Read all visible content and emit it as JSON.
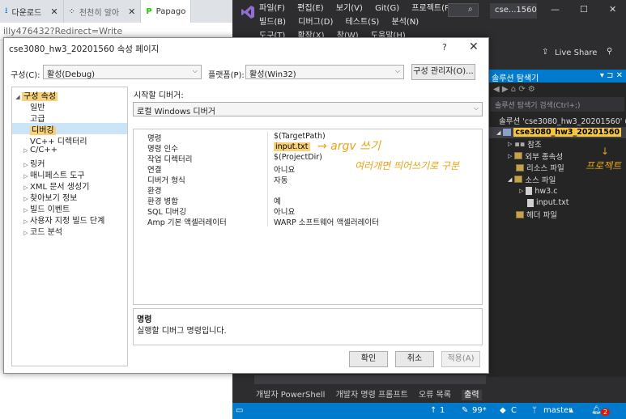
{
  "browser": {
    "tabs": [
      {
        "label": "다운로드",
        "icon": "download-icon"
      },
      {
        "label": "천천히 알아",
        "icon": "app-icon"
      },
      {
        "label": "Papago",
        "icon": "papago-icon"
      }
    ],
    "url_fragment": "illy476432?Redirect=Write"
  },
  "vs": {
    "menu": [
      "파일(F)",
      "편집(E)",
      "보기(V)",
      "Git(G)",
      "프로젝트(P)",
      "빌드(B)",
      "디버그(D)",
      "테스트(S)",
      "분석(N)",
      "도구(T)",
      "확장(X)",
      "창(W)",
      "도움말(H)"
    ],
    "title_pill": "cse...1560",
    "live_share": "Live Share",
    "solution_explorer": {
      "title": "솔루션 탐색기",
      "search_placeholder": "솔루션 탐색기 검색(Ctrl+;)",
      "items": [
        {
          "label": "솔루션 'cse3080_hw3_20201560' (",
          "indent": 0
        },
        {
          "label": "cse3080_hw3_20201560",
          "indent": 1
        },
        {
          "label": "참조",
          "indent": 2
        },
        {
          "label": "외부 종속성",
          "indent": 2
        },
        {
          "label": "리소스 파일",
          "indent": 2
        },
        {
          "label": "소스 파일",
          "indent": 2
        },
        {
          "label": "hw3.c",
          "indent": 3
        },
        {
          "label": "input.txt",
          "indent": 3
        },
        {
          "label": "헤더 파일",
          "indent": 2
        }
      ]
    },
    "bottom_tabs": [
      "개발자 PowerShell",
      "개발자 명령 프롬프트",
      "오류 목록",
      "출력"
    ],
    "status": {
      "up": "1",
      "pencil": "99*",
      "c": "C",
      "branch": "master",
      "notifications": "2"
    }
  },
  "dialog": {
    "title": "cse3080_hw3_20201560 속성 페이지",
    "config_label": "구성(C):",
    "config_value": "활성(Debug)",
    "platform_label": "플랫폼(P):",
    "platform_value": "활성(Win32)",
    "config_manager_button": "구성 관리자(O)...",
    "tree": [
      {
        "label": "구성 속성",
        "level": 0,
        "expander": "◢"
      },
      {
        "label": "일반",
        "level": 1,
        "expander": ""
      },
      {
        "label": "고급",
        "level": 1,
        "expander": ""
      },
      {
        "label": "디버깅",
        "level": 1,
        "expander": "",
        "selected": true
      },
      {
        "label": "VC++ 디렉터리",
        "level": 1,
        "expander": ""
      },
      {
        "label": "C/C++",
        "level": 1,
        "expander": "▷"
      },
      {
        "label": "링커",
        "level": 1,
        "expander": "▷"
      },
      {
        "label": "매니페스트 도구",
        "level": 1,
        "expander": "▷"
      },
      {
        "label": "XML 문서 생성기",
        "level": 1,
        "expander": "▷"
      },
      {
        "label": "찾아보기 정보",
        "level": 1,
        "expander": "▷"
      },
      {
        "label": "빌드 이벤트",
        "level": 1,
        "expander": "▷"
      },
      {
        "label": "사용자 지정 빌드 단계",
        "level": 1,
        "expander": "▷"
      },
      {
        "label": "코드 분석",
        "level": 1,
        "expander": "▷"
      }
    ],
    "debugger_label": "시작할 디버거:",
    "debugger_value": "로컬 Windows 디버거",
    "properties": [
      {
        "name": "명령",
        "value": "$(TargetPath)"
      },
      {
        "name": "명령 인수",
        "value": "input.txt"
      },
      {
        "name": "작업 디렉터리",
        "value": "$(ProjectDir)"
      },
      {
        "name": "연결",
        "value": "아니요"
      },
      {
        "name": "디버거 형식",
        "value": "자동"
      },
      {
        "name": "환경",
        "value": ""
      },
      {
        "name": "환경 병합",
        "value": "예"
      },
      {
        "name": "SQL 디버깅",
        "value": "아니요"
      },
      {
        "name": "Amp 기본 액셀러레이터",
        "value": "WARP 소프트웨어 액셀러레이터"
      }
    ],
    "description_title": "명령",
    "description_text": "실행할 디버그 명령입니다.",
    "ok_button": "확인",
    "cancel_button": "취소",
    "apply_button": "적용(A)"
  },
  "annotations": {
    "argv": "→ argv 쓰기",
    "multiple": "여러개면 띄어쓰기로 구분",
    "project": "프로젝트"
  },
  "colors": {
    "vs_accent": "#007acc",
    "highlight": "#f4c542",
    "selection": "#cce4f7"
  }
}
